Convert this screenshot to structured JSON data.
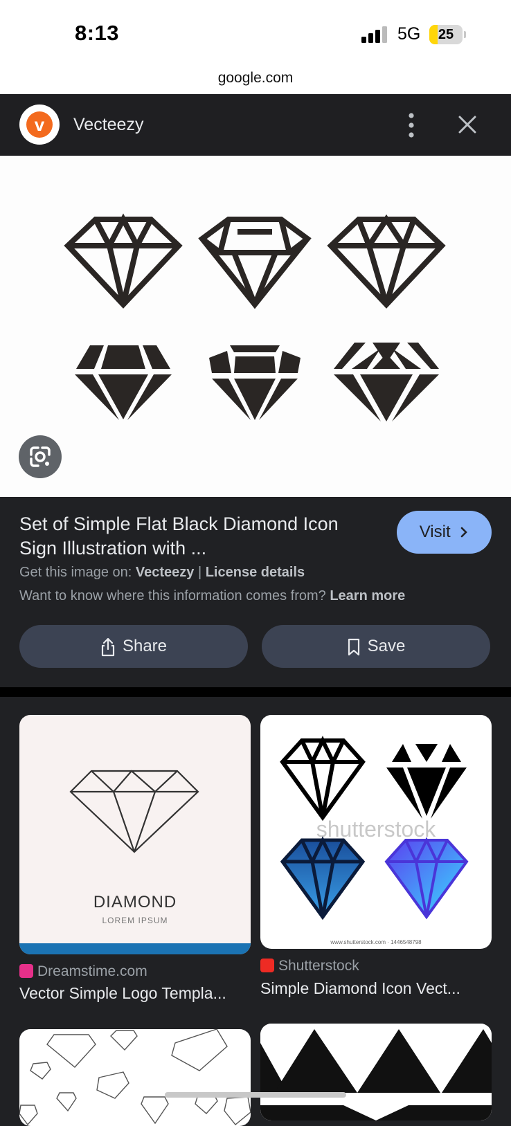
{
  "status_bar": {
    "time": "8:13",
    "network": "5G",
    "battery": "25",
    "battery_level": 0.25
  },
  "url_bar": {
    "domain": "google.com"
  },
  "header": {
    "site_name": "Vecteezy"
  },
  "details": {
    "title": "Set of Simple Flat Black Diamond Icon Sign Illustration with ...",
    "visit_label": "Visit",
    "get_image_prefix": "Get this image on:",
    "get_image_source": "Vecteezy",
    "separator": "|",
    "license_link": "License details",
    "info_question": "Want to know where this information comes from?",
    "learn_more": "Learn more",
    "share_label": "Share",
    "save_label": "Save"
  },
  "related": [
    {
      "source": "Dreamstime.com",
      "caption": "Vector Simple Logo Templa...",
      "image_text": "DIAMOND",
      "image_subtext": "LOREM IPSUM",
      "favicon_color": "#e6308a"
    },
    {
      "source": "Shutterstock",
      "caption": "Simple Diamond Icon Vect...",
      "watermark": "shutterstock",
      "image_id": "www.shutterstock.com · 1446548798",
      "favicon_color": "#ee2b24"
    }
  ],
  "colors": {
    "accent_button": "#8ab4f8",
    "background": "#202124",
    "pill_button": "#3c4353",
    "vecteezy_orange": "#f36a1e"
  }
}
